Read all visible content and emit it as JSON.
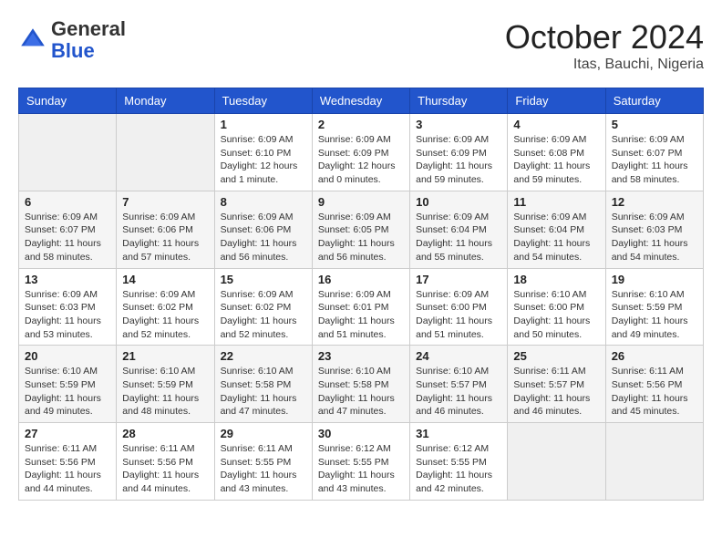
{
  "header": {
    "logo": {
      "general": "General",
      "blue": "Blue"
    },
    "title": "October 2024",
    "location": "Itas, Bauchi, Nigeria"
  },
  "calendar": {
    "weekdays": [
      "Sunday",
      "Monday",
      "Tuesday",
      "Wednesday",
      "Thursday",
      "Friday",
      "Saturday"
    ],
    "weeks": [
      [
        {
          "day": "",
          "info": ""
        },
        {
          "day": "",
          "info": ""
        },
        {
          "day": "1",
          "info": "Sunrise: 6:09 AM\nSunset: 6:10 PM\nDaylight: 12 hours\nand 1 minute."
        },
        {
          "day": "2",
          "info": "Sunrise: 6:09 AM\nSunset: 6:09 PM\nDaylight: 12 hours\nand 0 minutes."
        },
        {
          "day": "3",
          "info": "Sunrise: 6:09 AM\nSunset: 6:09 PM\nDaylight: 11 hours\nand 59 minutes."
        },
        {
          "day": "4",
          "info": "Sunrise: 6:09 AM\nSunset: 6:08 PM\nDaylight: 11 hours\nand 59 minutes."
        },
        {
          "day": "5",
          "info": "Sunrise: 6:09 AM\nSunset: 6:07 PM\nDaylight: 11 hours\nand 58 minutes."
        }
      ],
      [
        {
          "day": "6",
          "info": "Sunrise: 6:09 AM\nSunset: 6:07 PM\nDaylight: 11 hours\nand 58 minutes."
        },
        {
          "day": "7",
          "info": "Sunrise: 6:09 AM\nSunset: 6:06 PM\nDaylight: 11 hours\nand 57 minutes."
        },
        {
          "day": "8",
          "info": "Sunrise: 6:09 AM\nSunset: 6:06 PM\nDaylight: 11 hours\nand 56 minutes."
        },
        {
          "day": "9",
          "info": "Sunrise: 6:09 AM\nSunset: 6:05 PM\nDaylight: 11 hours\nand 56 minutes."
        },
        {
          "day": "10",
          "info": "Sunrise: 6:09 AM\nSunset: 6:04 PM\nDaylight: 11 hours\nand 55 minutes."
        },
        {
          "day": "11",
          "info": "Sunrise: 6:09 AM\nSunset: 6:04 PM\nDaylight: 11 hours\nand 54 minutes."
        },
        {
          "day": "12",
          "info": "Sunrise: 6:09 AM\nSunset: 6:03 PM\nDaylight: 11 hours\nand 54 minutes."
        }
      ],
      [
        {
          "day": "13",
          "info": "Sunrise: 6:09 AM\nSunset: 6:03 PM\nDaylight: 11 hours\nand 53 minutes."
        },
        {
          "day": "14",
          "info": "Sunrise: 6:09 AM\nSunset: 6:02 PM\nDaylight: 11 hours\nand 52 minutes."
        },
        {
          "day": "15",
          "info": "Sunrise: 6:09 AM\nSunset: 6:02 PM\nDaylight: 11 hours\nand 52 minutes."
        },
        {
          "day": "16",
          "info": "Sunrise: 6:09 AM\nSunset: 6:01 PM\nDaylight: 11 hours\nand 51 minutes."
        },
        {
          "day": "17",
          "info": "Sunrise: 6:09 AM\nSunset: 6:00 PM\nDaylight: 11 hours\nand 51 minutes."
        },
        {
          "day": "18",
          "info": "Sunrise: 6:10 AM\nSunset: 6:00 PM\nDaylight: 11 hours\nand 50 minutes."
        },
        {
          "day": "19",
          "info": "Sunrise: 6:10 AM\nSunset: 5:59 PM\nDaylight: 11 hours\nand 49 minutes."
        }
      ],
      [
        {
          "day": "20",
          "info": "Sunrise: 6:10 AM\nSunset: 5:59 PM\nDaylight: 11 hours\nand 49 minutes."
        },
        {
          "day": "21",
          "info": "Sunrise: 6:10 AM\nSunset: 5:59 PM\nDaylight: 11 hours\nand 48 minutes."
        },
        {
          "day": "22",
          "info": "Sunrise: 6:10 AM\nSunset: 5:58 PM\nDaylight: 11 hours\nand 47 minutes."
        },
        {
          "day": "23",
          "info": "Sunrise: 6:10 AM\nSunset: 5:58 PM\nDaylight: 11 hours\nand 47 minutes."
        },
        {
          "day": "24",
          "info": "Sunrise: 6:10 AM\nSunset: 5:57 PM\nDaylight: 11 hours\nand 46 minutes."
        },
        {
          "day": "25",
          "info": "Sunrise: 6:11 AM\nSunset: 5:57 PM\nDaylight: 11 hours\nand 46 minutes."
        },
        {
          "day": "26",
          "info": "Sunrise: 6:11 AM\nSunset: 5:56 PM\nDaylight: 11 hours\nand 45 minutes."
        }
      ],
      [
        {
          "day": "27",
          "info": "Sunrise: 6:11 AM\nSunset: 5:56 PM\nDaylight: 11 hours\nand 44 minutes."
        },
        {
          "day": "28",
          "info": "Sunrise: 6:11 AM\nSunset: 5:56 PM\nDaylight: 11 hours\nand 44 minutes."
        },
        {
          "day": "29",
          "info": "Sunrise: 6:11 AM\nSunset: 5:55 PM\nDaylight: 11 hours\nand 43 minutes."
        },
        {
          "day": "30",
          "info": "Sunrise: 6:12 AM\nSunset: 5:55 PM\nDaylight: 11 hours\nand 43 minutes."
        },
        {
          "day": "31",
          "info": "Sunrise: 6:12 AM\nSunset: 5:55 PM\nDaylight: 11 hours\nand 42 minutes."
        },
        {
          "day": "",
          "info": ""
        },
        {
          "day": "",
          "info": ""
        }
      ]
    ]
  }
}
